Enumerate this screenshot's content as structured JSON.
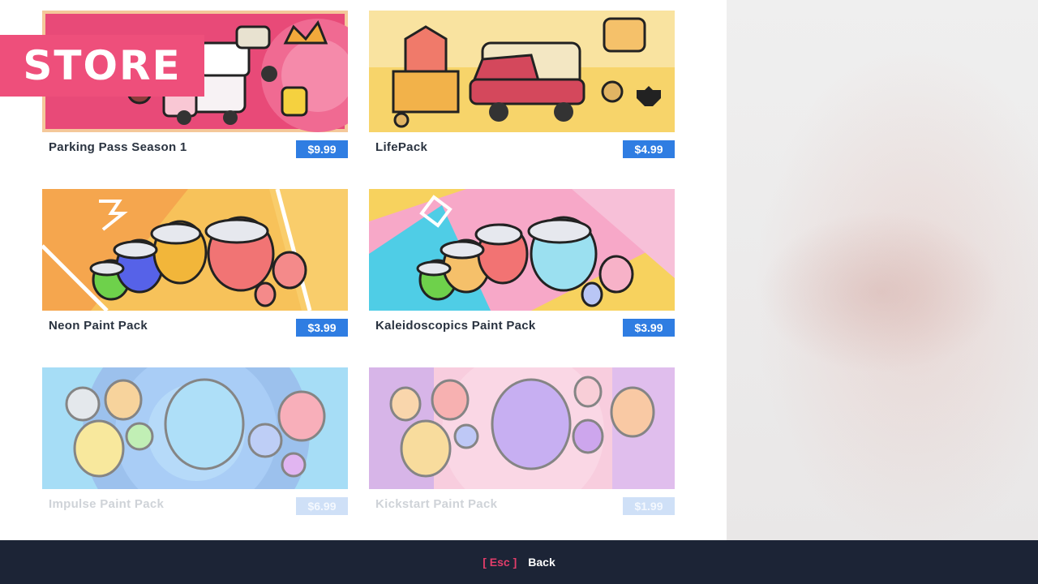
{
  "store_title": "STORE",
  "items": [
    {
      "title": "Parking Pass Season 1",
      "price": "$9.99",
      "state": "normal"
    },
    {
      "title": "LifePack",
      "price": "$4.99",
      "state": "normal"
    },
    {
      "title": "Neon Paint Pack",
      "price": "$3.99",
      "state": "normal"
    },
    {
      "title": "Kaleidoscopics Paint Pack",
      "price": "$3.99",
      "state": "normal"
    },
    {
      "title": "Impulse Paint Pack",
      "price": "$6.99",
      "state": "faded"
    },
    {
      "title": "Kickstart Paint Pack",
      "price": "$1.99",
      "state": "faded"
    }
  ],
  "footer": {
    "key": "[ Esc ]",
    "label": "Back"
  },
  "colors": {
    "banner": "#ee4f7b",
    "price_tag": "#2f7de2",
    "footer_bg": "#1c2436",
    "footer_key": "#e23d6a"
  }
}
